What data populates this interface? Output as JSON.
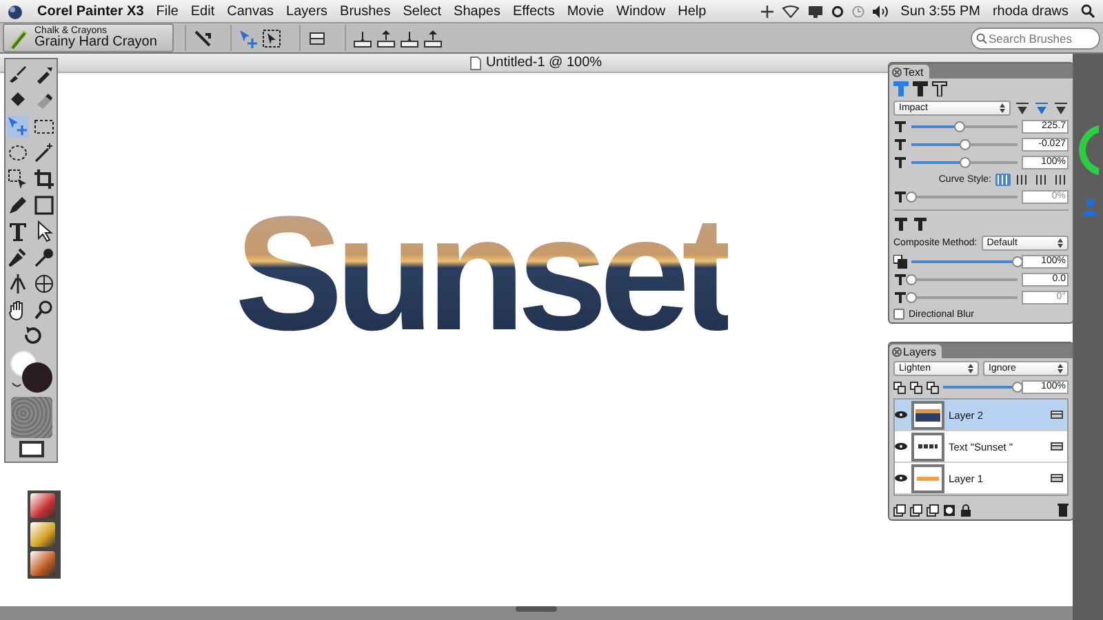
{
  "menu_bar": {
    "app": "Corel Painter X3",
    "items": [
      "File",
      "Edit",
      "Canvas",
      "Layers",
      "Brushes",
      "Select",
      "Shapes",
      "Effects",
      "Movie",
      "Window",
      "Help"
    ],
    "clock": "Sun 3:55 PM",
    "user": "rhoda draws"
  },
  "property_bar": {
    "brush_category": "Chalk & Crayons",
    "brush_variant": "Grainy Hard Crayon",
    "search": {
      "placeholder": "Search Brushes"
    }
  },
  "document": {
    "title": "Untitled-1 @ 100%",
    "canvas_text": "Sunset"
  },
  "toolbox": {
    "tools": [
      {
        "selected": false
      },
      {
        "selected": false
      },
      {
        "selected": false
      },
      {
        "selected": false
      },
      {
        "selected": true
      },
      {
        "selected": false
      },
      {
        "selected": false
      },
      {
        "selected": false
      },
      {
        "selected": false
      },
      {
        "selected": false
      },
      {
        "selected": false
      },
      {
        "selected": false
      },
      {
        "selected": false
      },
      {
        "selected": false
      },
      {
        "selected": false
      },
      {
        "selected": false
      },
      {
        "selected": false
      },
      {
        "selected": false
      },
      {
        "selected": false
      },
      {
        "selected": false
      },
      {
        "selected": false
      }
    ]
  },
  "text_panel": {
    "title": "Text",
    "text_styles": [
      {
        "selected": true
      },
      {
        "selected": false
      },
      {
        "selected": false
      }
    ],
    "font": "Impact",
    "alignments": [
      {
        "selected": false
      },
      {
        "selected": true
      },
      {
        "selected": false
      }
    ],
    "sliders": [
      {
        "level": 0.45,
        "value": "225.7",
        "disabled": false
      },
      {
        "level": 0.5,
        "value": "-0.027",
        "disabled": false
      },
      {
        "level": 0.51,
        "value": "100%",
        "disabled": false
      }
    ],
    "curve_style_label": "Curve Style:",
    "curve_styles": [
      {
        "selected": true
      },
      {
        "selected": false
      },
      {
        "selected": false
      },
      {
        "selected": false
      }
    ],
    "baseline": {
      "level": 0,
      "value": "0%",
      "disabled": true
    },
    "effect_styles": [
      {
        "selected": false
      },
      {
        "selected": false
      }
    ],
    "composite_method_label": "Composite Method:",
    "composite_method": "Default",
    "effect_sliders": [
      {
        "level": 1,
        "value": "100%",
        "disabled": false
      },
      {
        "level": 0,
        "value": "0.0",
        "disabled": false
      },
      {
        "level": 0,
        "value": "0°",
        "disabled": true
      }
    ],
    "directional_blur": {
      "label": "Directional Blur",
      "checked": false
    }
  },
  "layers_panel": {
    "title": "Layers",
    "composite": "Lighten",
    "depth": "Ignore",
    "opacity": {
      "level": 1,
      "value": "100%"
    },
    "layers": [
      {
        "name": "Layer 2",
        "selected": true,
        "visible": true
      },
      {
        "name": "Text \"Sunset \"",
        "selected": false,
        "visible": true
      },
      {
        "name": "Layer 1",
        "selected": false,
        "visible": true
      }
    ]
  }
}
